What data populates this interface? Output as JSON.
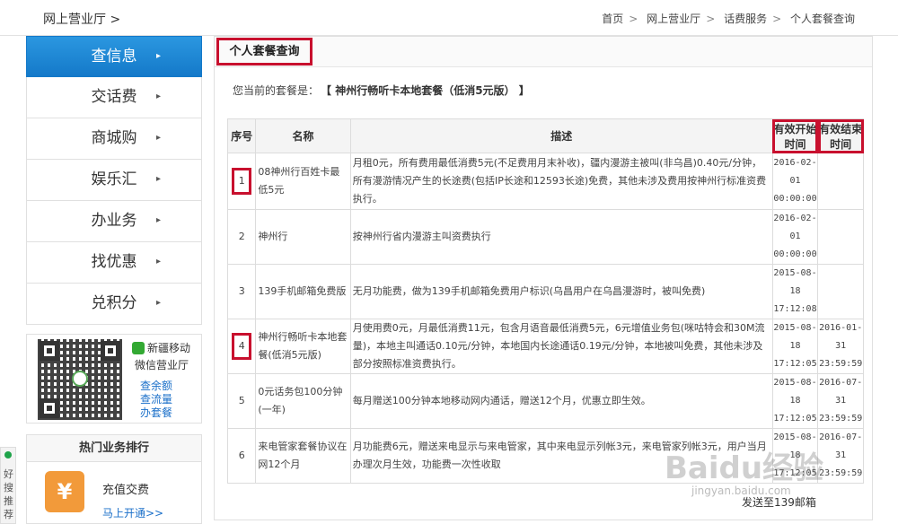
{
  "topbar": {
    "title": "网上营业厅 >",
    "breadcrumb": [
      "首页",
      "网上营业厅",
      "话费服务",
      "个人套餐查询"
    ],
    "sep": ">"
  },
  "sidebar": {
    "items": [
      {
        "label": "查信息",
        "arrow": "▸"
      },
      {
        "label": "交话费",
        "arrow": "▸"
      },
      {
        "label": "商城购",
        "arrow": "▸"
      },
      {
        "label": "娱乐汇",
        "arrow": "▸"
      },
      {
        "label": "办业务",
        "arrow": "▸"
      },
      {
        "label": "找优惠",
        "arrow": "▸"
      },
      {
        "label": "兑积分",
        "arrow": "▸"
      }
    ]
  },
  "wechat": {
    "line1": "新疆移动",
    "line2": "微信营业厅",
    "links": [
      "查余额",
      "查流量",
      "办套餐"
    ]
  },
  "hot": {
    "title": "热门业务排行",
    "name": "充值交费",
    "link": "马上开通>>"
  },
  "side_tab": "好搜推荐",
  "main": {
    "title": "个人套餐查询",
    "current_label": "您当前的套餐是：",
    "current_value": "【 神州行畅听卡本地套餐（低消5元版） 】",
    "headers": [
      "序号",
      "名称",
      "描述",
      "有效开始时间",
      "有效结束时间"
    ],
    "rows": [
      {
        "no": "1",
        "name": "08神州行百姓卡最低5元",
        "desc": "月租0元，所有费用最低消费5元(不足费用月末补收)，疆内漫游主被叫(非乌昌)0.40元/分钟，所有漫游情况产生的长途费(包括IP长途和12593长途)免费，其他未涉及费用按神州行标准资费执行。",
        "start": "2016-02-01 00:00:00",
        "end": ""
      },
      {
        "no": "2",
        "name": "神州行",
        "desc": "按神州行省内漫游主叫资费执行",
        "start": "2016-02-01 00:00:00",
        "end": ""
      },
      {
        "no": "3",
        "name": "139手机邮箱免费版",
        "desc": "无月功能费，做为139手机邮箱免费用户标识(乌昌用户在乌昌漫游时，被叫免费)",
        "start": "2015-08-18 17:12:08",
        "end": ""
      },
      {
        "no": "4",
        "name": "神州行畅听卡本地套餐(低消5元版)",
        "desc": "月使用费0元，月最低消费11元，包含月语音最低消费5元，6元增值业务包(咪咕特会和30M流量)，本地主叫通话0.10元/分钟，本地国内长途通话0.19元/分钟，本地被叫免费，其他未涉及部分按照标准资费执行。",
        "start": "2015-08-18 17:12:05",
        "end": "2016-01-31 23:59:59"
      },
      {
        "no": "5",
        "name": "0元话务包100分钟(一年)",
        "desc": "每月赠送100分钟本地移动网内通话，赠送12个月，优惠立即生效。",
        "start": "2015-08-18 17:12:05",
        "end": "2016-07-31 23:59:59"
      },
      {
        "no": "6",
        "name": "来电管家套餐协议在网12个月",
        "desc": "月功能费6元，赠送来电显示与来电管家，其中来电显示列帐3元，来电管家列帐3元，用户当月办理次月生效，功能费一次性收取",
        "start": "2015-08-18 17:12:05",
        "end": "2016-07-31 23:59:59"
      }
    ]
  },
  "footer_text": "发送至139邮箱",
  "watermark": "Baidu经验",
  "watermark_url": "jingyan.baidu.com",
  "colors": {
    "accent": "#1479c9",
    "highlight": "#c8102e"
  }
}
